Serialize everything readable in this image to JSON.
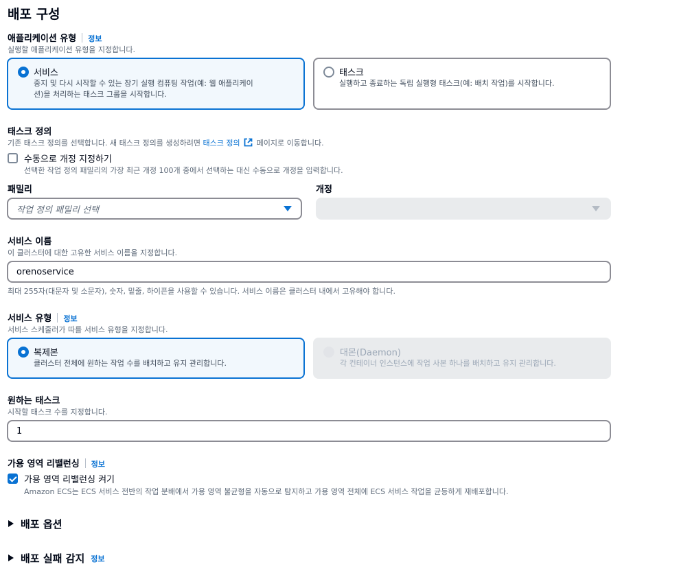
{
  "page_title": "배포 구성",
  "app_type": {
    "label": "애플리케이션 유형",
    "info": "정보",
    "description": "실행할 애플리케이션 유형을 지정합니다.",
    "options": [
      {
        "title": "서비스",
        "description_line1": "중지 및 다시 시작할 수 있는 장기 실행 컴퓨팅 작업(예: 웹 애플리케이",
        "description_line2": "션)을 처리하는 태스크 그룹을 시작합니다.",
        "selected": true
      },
      {
        "title": "태스크",
        "description_line1": "실행하고 종료하는 독립 실행형 태스크(예: 배치 작업)를 시작합니다.",
        "selected": false
      }
    ]
  },
  "task_definition": {
    "label": "태스크 정의",
    "description_before": "기존 태스크 정의를 선택합니다. 새 태스크 정의를 생성하려면",
    "link_text": "태스크 정의",
    "description_after": "페이지로 이동합니다.",
    "manual_revision": {
      "label": "수동으로 개정 지정하기",
      "description": "선택한 작업 정의 패밀리의 가장 최근 개정 100개 중에서 선택하는 대신 수동으로 개정을 입력합니다.",
      "checked": false
    },
    "family": {
      "label": "패밀리",
      "placeholder": "작업 정의 패밀리 선택"
    },
    "revision": {
      "label": "개정",
      "value": ""
    }
  },
  "service_name": {
    "label": "서비스 이름",
    "description": "이 클러스터에 대한 고유한 서비스 이름을 지정합니다.",
    "value": "orenoservice",
    "constraint": "최대 255자(대문자 및 소문자), 숫자, 밑줄, 하이픈을 사용할 수 있습니다. 서비스 이름은 클러스터 내에서 고유해야 합니다."
  },
  "service_type": {
    "label": "서비스 유형",
    "info": "정보",
    "description": "서비스 스케줄러가 따를 서비스 유형을 지정합니다.",
    "options": [
      {
        "title": "복제본",
        "description": "클러스터 전체에 원하는 작업 수를 배치하고 유지 관리합니다.",
        "selected": true,
        "disabled": false
      },
      {
        "title": "대몬(Daemon)",
        "description": "각 컨테이너 인스턴스에 작업 사본 하나를 배치하고 유지 관리합니다.",
        "selected": false,
        "disabled": true
      }
    ]
  },
  "desired_tasks": {
    "label": "원하는 태스크",
    "description": "시작할 태스크 수를 지정합니다.",
    "value": "1"
  },
  "az_rebalancing": {
    "label": "가용 영역 리밸런싱",
    "info": "정보",
    "checkbox_label": "가용 영역 리밸런싱 켜기",
    "checkbox_description": "Amazon ECS는 ECS 서비스 전반의 작업 분배에서 가용 영역 불균형을 자동으로 탐지하고 가용 영역 전체에 ECS 서비스 작업을 균등하게 재배포합니다.",
    "checked": true
  },
  "sections": [
    {
      "title": "배포 옵션"
    },
    {
      "title": "배포 실패 감지",
      "info": "정보"
    }
  ],
  "colors": {
    "accent": "#0972d3",
    "selected_bg": "#f2f8fd",
    "disabled_bg": "#e9ebed",
    "text": "#000716",
    "secondary": "#5f6b7a"
  }
}
